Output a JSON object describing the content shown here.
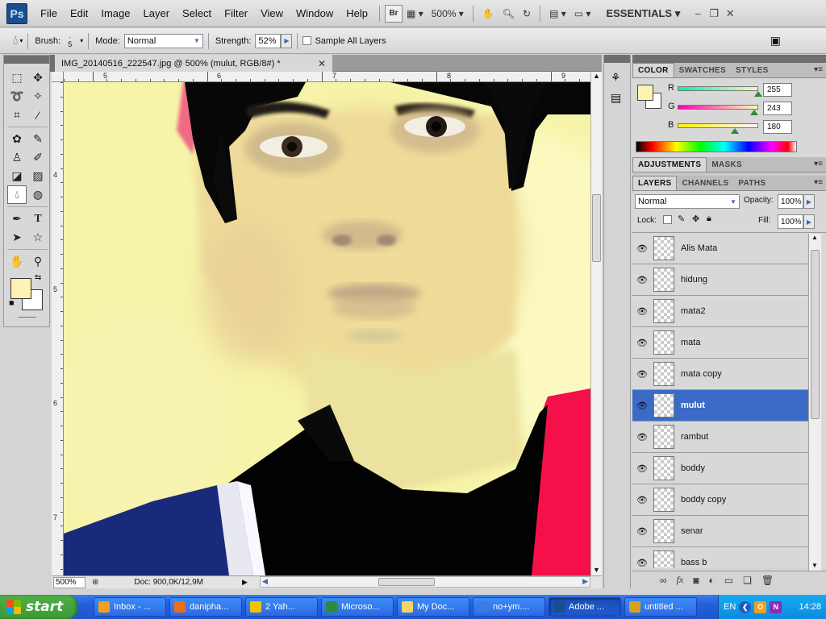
{
  "app": {
    "logo": "Ps"
  },
  "menu": [
    "File",
    "Edit",
    "Image",
    "Layer",
    "Select",
    "Filter",
    "View",
    "Window",
    "Help"
  ],
  "menubar": {
    "bridge": "Br",
    "zoom": "500%",
    "workspace": "ESSENTIALS",
    "win_min": "–",
    "win_restore": "❐",
    "win_close": "✕"
  },
  "options": {
    "brush_label": "Brush:",
    "brush_size": "5",
    "mode_label": "Mode:",
    "mode_value": "Normal",
    "strength_label": "Strength:",
    "strength_value": "52%",
    "sample_all_layers": "Sample All Layers"
  },
  "document": {
    "tab_title": "IMG_20140516_222547.jpg @ 500% (mulut, RGB/8#) *",
    "close": "✕",
    "ruler_top": [
      "5",
      "6",
      "7",
      "8",
      "9"
    ],
    "ruler_left": [
      "4",
      "5",
      "6",
      "7"
    ]
  },
  "status": {
    "zoom": "500%",
    "doc_info": "Doc: 900,0K/12,9M"
  },
  "color_panel": {
    "tabs": [
      "COLOR",
      "SWATCHES",
      "STYLES"
    ],
    "r_label": "R",
    "g_label": "G",
    "b_label": "B",
    "r": "255",
    "g": "243",
    "b": "180",
    "r_level": 1.0,
    "g_level": 0.953,
    "b_level": 0.706,
    "foreground_hex": "#fff3b4"
  },
  "adjustments_panel": {
    "tabs": [
      "ADJUSTMENTS",
      "MASKS"
    ]
  },
  "layers_panel": {
    "tabs": [
      "LAYERS",
      "CHANNELS",
      "PATHS"
    ],
    "blend_mode": "Normal",
    "opacity_label": "Opacity:",
    "opacity": "100%",
    "lock_label": "Lock:",
    "fill_label": "Fill:",
    "fill": "100%",
    "layers": [
      {
        "name": "Alis Mata",
        "selected": false
      },
      {
        "name": "hidung",
        "selected": false
      },
      {
        "name": "mata2",
        "selected": false
      },
      {
        "name": "mata",
        "selected": false
      },
      {
        "name": "mata copy",
        "selected": false
      },
      {
        "name": "mulut",
        "selected": true
      },
      {
        "name": "rambut",
        "selected": false
      },
      {
        "name": "boddy",
        "selected": false
      },
      {
        "name": "boddy copy",
        "selected": false
      },
      {
        "name": "senar",
        "selected": false
      },
      {
        "name": "bass b",
        "selected": false
      }
    ]
  },
  "taskbar": {
    "start": "start",
    "tasks": [
      {
        "label": "Inbox - ...",
        "color": "#f0a020"
      },
      {
        "label": "danipha...",
        "color": "#e8701a"
      },
      {
        "label": "2 Yah...",
        "color": "#f2c200"
      },
      {
        "label": "Microso...",
        "color": "#2e8b3e"
      },
      {
        "label": "My Doc...",
        "color": "#f5d56a"
      },
      {
        "label": "no+ym....",
        "color": "#3a7be0"
      },
      {
        "label": "Adobe ...",
        "color": "#1a4f8f"
      },
      {
        "label": "untitled ...",
        "color": "#d9a020"
      }
    ],
    "tray_lang": "EN",
    "clock": "14:28"
  },
  "colors": {
    "accent_selected": "#3b6bc6",
    "taskbar_blue": "#245edb",
    "start_green": "#3a9a34"
  }
}
